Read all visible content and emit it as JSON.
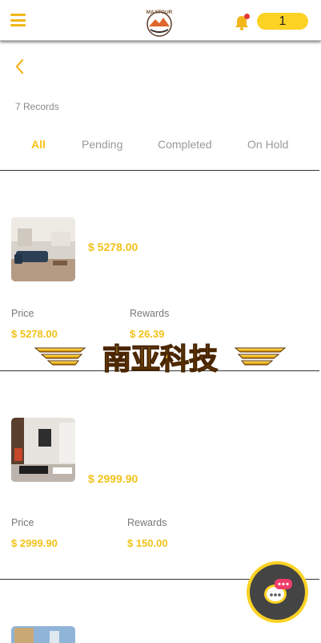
{
  "header": {
    "logo_text": "MAXTOUR",
    "counter": "1",
    "colors": {
      "accent": "#f3b61b",
      "badge": "#e53935",
      "counter_bg": "#fcd224"
    }
  },
  "records_label": "7 Records",
  "tabs": [
    {
      "label": "All",
      "active": true
    },
    {
      "label": "Pending",
      "active": false
    },
    {
      "label": "Completed",
      "active": false
    },
    {
      "label": "On Hold",
      "active": false
    }
  ],
  "orders": [
    {
      "amount": "$ 5278.00",
      "price_label": "Price",
      "price": "$ 5278.00",
      "rewards_label": "Rewards",
      "rewards": "$ 26.39"
    },
    {
      "amount": "$ 2999.90",
      "price_label": "Price",
      "price": "$ 2999.90",
      "rewards_label": "Rewards",
      "rewards": "$ 150.00"
    }
  ],
  "overlay_banner_text": "南亚科技"
}
